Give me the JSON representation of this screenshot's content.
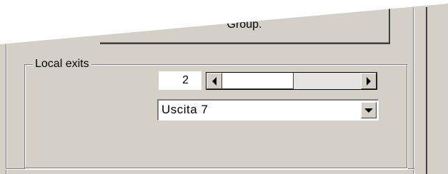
{
  "top_button": {
    "label": "Group."
  },
  "local_exits": {
    "title": "Local exits",
    "number_value": "2",
    "exit_select": {
      "selected": "Uscita  7"
    }
  },
  "icons": {
    "scroll_left": "triangle-left-icon",
    "scroll_right": "triangle-right-icon",
    "dropdown": "triangle-down-icon"
  },
  "colors": {
    "face": "#d4d0c8",
    "field": "#ffffff"
  }
}
